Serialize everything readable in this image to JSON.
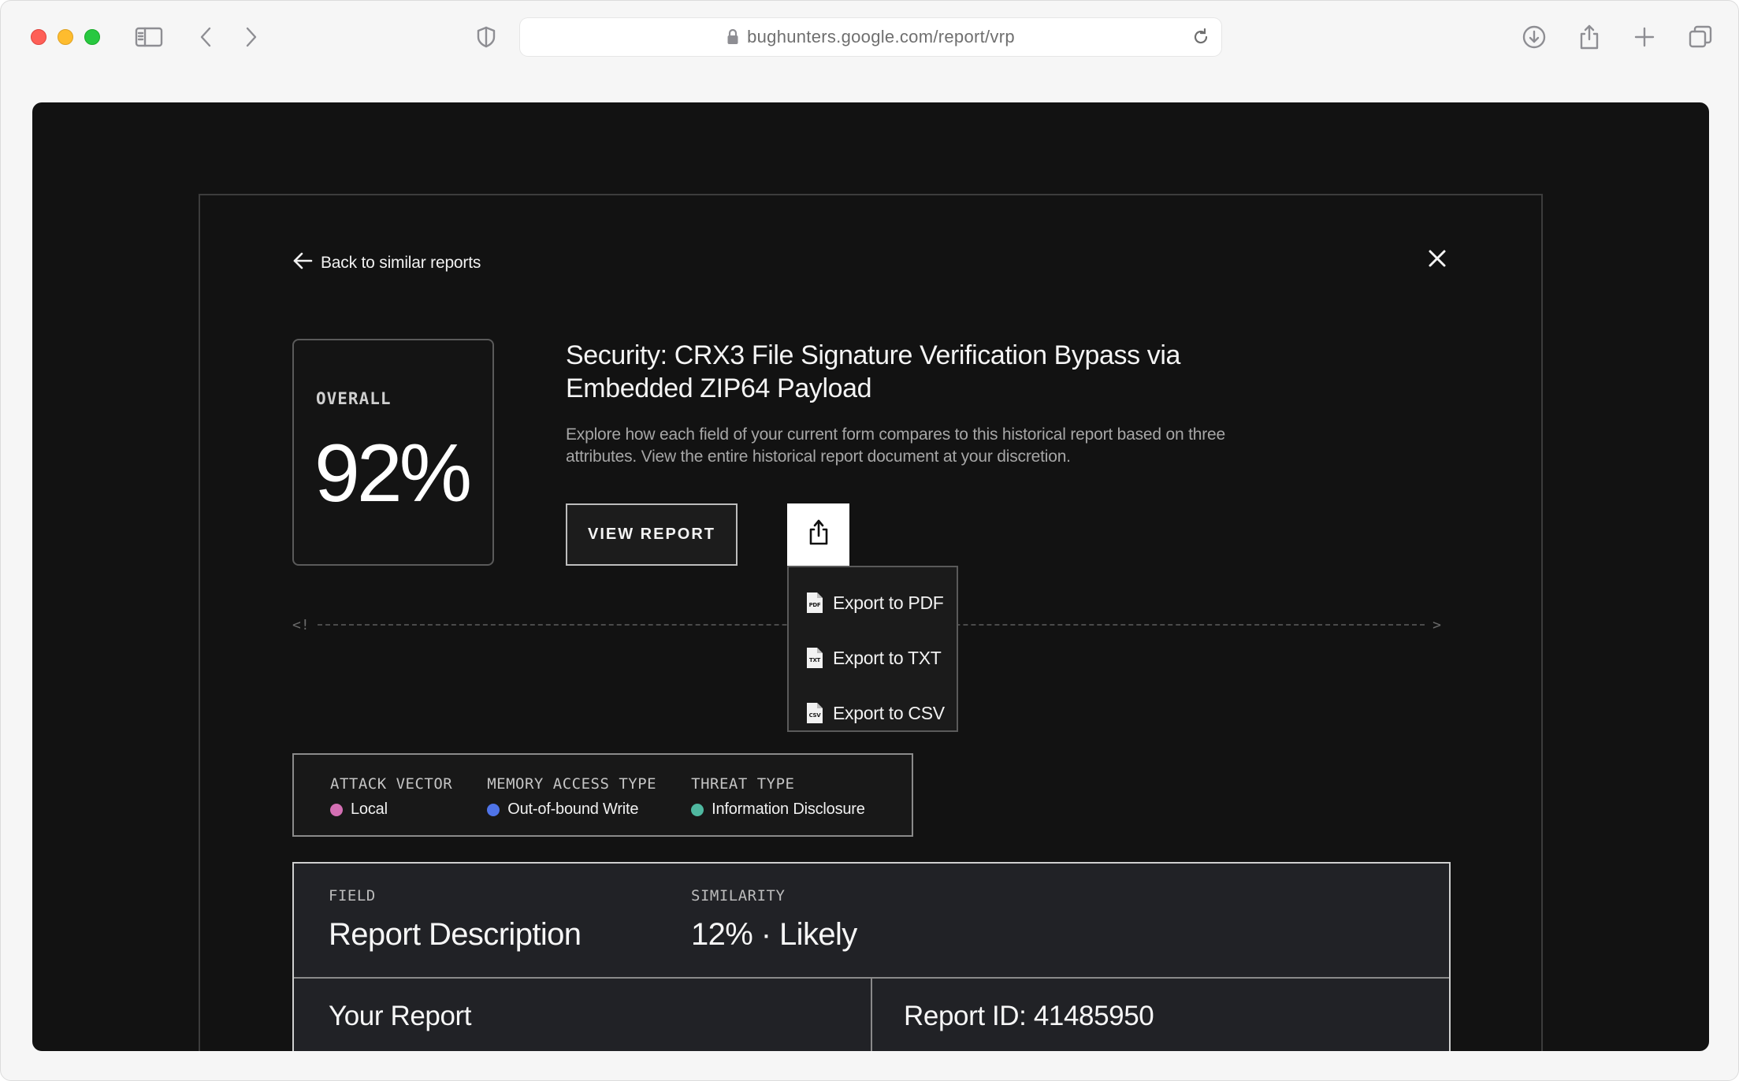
{
  "browser": {
    "url": "bughunters.google.com/report/vrp"
  },
  "modal": {
    "back_label": "Back to similar reports",
    "score": {
      "label": "OVERALL",
      "value": "92%"
    },
    "title": "Security: CRX3 File Signature Verification Bypass via Embedded ZIP64 Payload",
    "description": "Explore how each field of your current form compares to this historical report based on three attributes. View the entire historical report document at your discretion.",
    "view_report_label": "VIEW REPORT",
    "divider": {
      "left": "<!",
      "right": ">"
    },
    "export_menu": {
      "items": [
        {
          "label": "Export to PDF",
          "icon": "pdf-file-icon",
          "badge": "PDF"
        },
        {
          "label": "Export to TXT",
          "icon": "txt-file-icon",
          "badge": "TXT"
        },
        {
          "label": "Export to CSV",
          "icon": "csv-file-icon",
          "badge": "CSV"
        }
      ]
    },
    "attributes": [
      {
        "label": "ATTACK VECTOR",
        "value": "Local",
        "color": "#d36fb3"
      },
      {
        "label": "MEMORY ACCESS TYPE",
        "value": "Out-of-bound Write",
        "color": "#4f74e8"
      },
      {
        "label": "THREAT TYPE",
        "value": "Information Disclosure",
        "color": "#4fb8a0"
      }
    ],
    "field_card": {
      "field_label": "FIELD",
      "field_value": "Report Description",
      "similarity_label": "SIMILARITY",
      "similarity_value": "12% · Likely",
      "your_report": "Your Report",
      "report_id": "Report ID: 41485950"
    }
  }
}
